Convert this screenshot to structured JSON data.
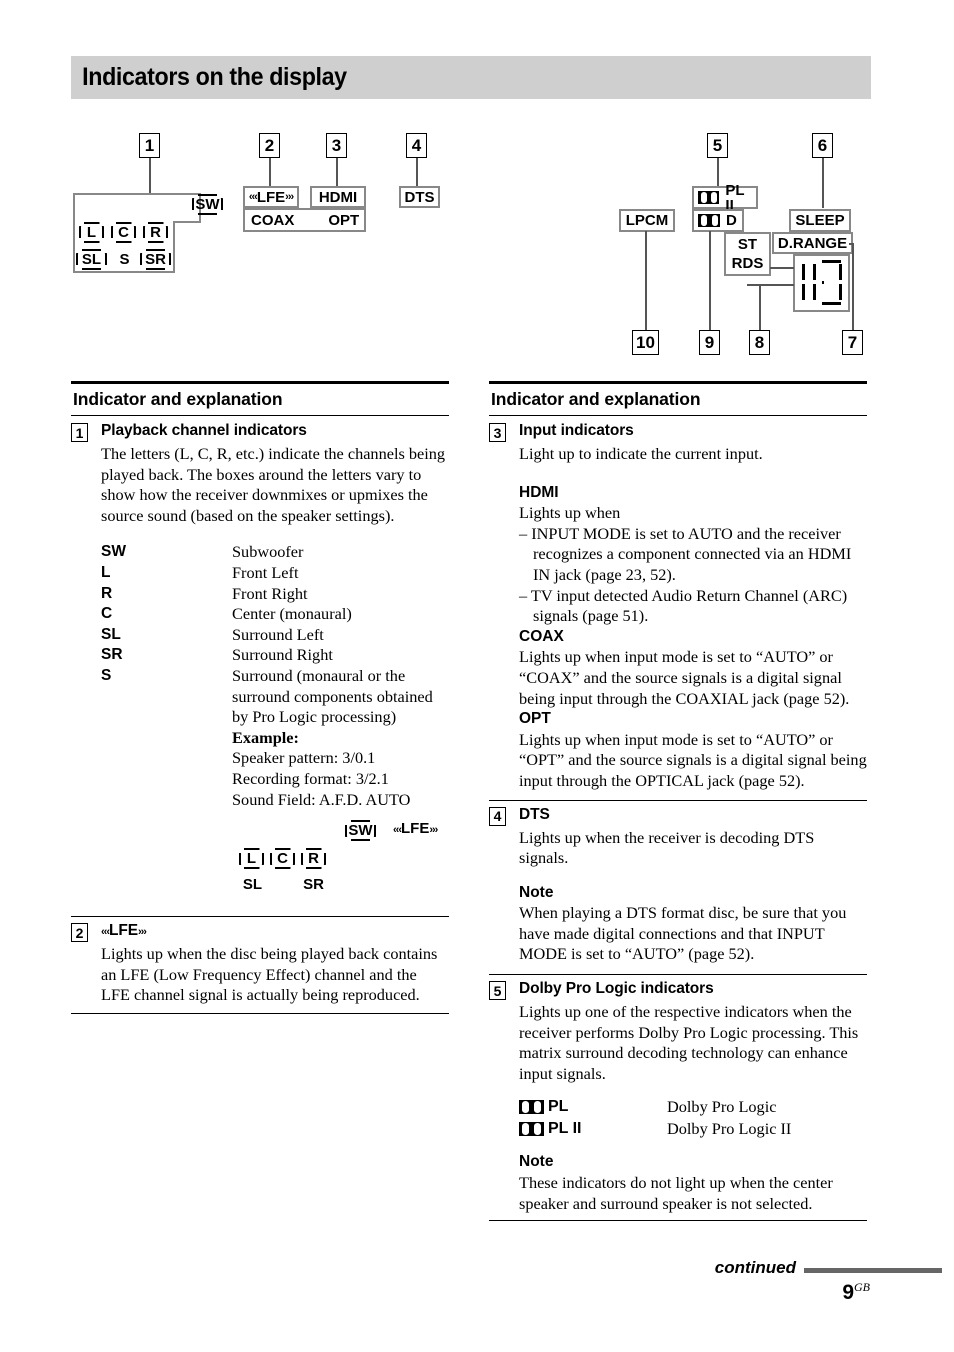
{
  "page": {
    "title": "Indicators on the display",
    "footer_continued": "continued",
    "page_number": "9",
    "page_region": "GB"
  },
  "diagram": {
    "callouts": {
      "n1": "1",
      "n2": "2",
      "n3": "3",
      "n4": "4",
      "n5": "5",
      "n6": "6",
      "n7": "7",
      "n8": "8",
      "n9": "9",
      "n10": "10"
    },
    "left_panel": {
      "sw": "SW",
      "row1": [
        "L",
        "C",
        "R"
      ],
      "row2": [
        "SL",
        "S",
        "SR"
      ]
    },
    "input_panel": {
      "lfe": "LFE",
      "hdmi": "HDMI",
      "coax": "COAX",
      "opt": "OPT"
    },
    "dts": "DTS",
    "right_panel": {
      "lpcm": "LPCM",
      "pl2": "PL II",
      "dolby_d": "D",
      "st": "ST",
      "rds": "RDS",
      "sleep": "SLEEP",
      "drange": "D.RANGE"
    }
  },
  "left_column": {
    "section_heading": "Indicator and explanation",
    "item1": {
      "number": "1",
      "heading": "Playback channel indicators",
      "body": "The letters (L, C, R, etc.) indicate the channels being played back. The boxes around the letters vary to show how the receiver downmixes or upmixes the source sound (based on the speaker settings).",
      "definitions": [
        {
          "term": "SW",
          "desc": "Subwoofer"
        },
        {
          "term": "L",
          "desc": "Front Left"
        },
        {
          "term": "R",
          "desc": "Front Right"
        },
        {
          "term": "C",
          "desc": "Center (monaural)"
        },
        {
          "term": "SL",
          "desc": "Surround Left"
        },
        {
          "term": "SR",
          "desc": "Surround Right"
        },
        {
          "term": "S",
          "desc": "Surround (monaural or the surround components obtained by Pro Logic processing)"
        }
      ],
      "example_label": "Example:",
      "example_lines": [
        "Speaker pattern: 3/0.1",
        "Recording format: 3/2.1",
        "Sound Field: A.F.D. AUTO"
      ],
      "example_diagram": {
        "sw": "SW",
        "lfe": "LFE",
        "row1": [
          "L",
          "C",
          "R"
        ],
        "row2": [
          "SL",
          "SR"
        ]
      }
    },
    "item2": {
      "number": "2",
      "heading_lfe": "LFE",
      "body": "Lights up when the disc being played back contains an LFE (Low Frequency Effect) channel and the LFE channel signal is actually being reproduced."
    }
  },
  "right_column": {
    "section_heading": "Indicator and explanation",
    "item3": {
      "number": "3",
      "heading": "Input indicators",
      "body": "Light up to indicate the current input.",
      "hdmi": {
        "title": "HDMI",
        "intro": "Lights up when",
        "bullets": [
          "– INPUT MODE is set to AUTO and the receiver recognizes a component connected via an HDMI IN jack (page 23, 52).",
          "– TV input detected Audio Return Channel (ARC) signals (page 51)."
        ]
      },
      "coax": {
        "title": "COAX",
        "body": "Lights up when input mode is set to “AUTO” or “COAX” and the source signals is a digital signal being input through the COAXIAL jack (page 52)."
      },
      "opt": {
        "title": "OPT",
        "body": "Lights up when input mode is set to “AUTO” or “OPT” and the source signals is a digital signal being input through the OPTICAL jack (page 52)."
      }
    },
    "item4": {
      "number": "4",
      "heading": "DTS",
      "body": "Lights up when the receiver is decoding DTS signals.",
      "note_title": "Note",
      "note_body": "When playing a DTS format disc, be sure that you have made digital connections and that INPUT MODE is set to “AUTO” (page 52)."
    },
    "item5": {
      "number": "5",
      "heading": "Dolby Pro Logic indicators",
      "body": "Lights up one of the respective indicators when the receiver performs Dolby Pro Logic processing. This matrix surround decoding technology can enhance input signals.",
      "rows": [
        {
          "term": "PL",
          "desc": "Dolby Pro Logic"
        },
        {
          "term": "PL II",
          "desc": "Dolby Pro Logic II"
        }
      ],
      "note_title": "Note",
      "note_body": "These indicators do not light up when the center speaker and surround speaker is not selected."
    }
  }
}
